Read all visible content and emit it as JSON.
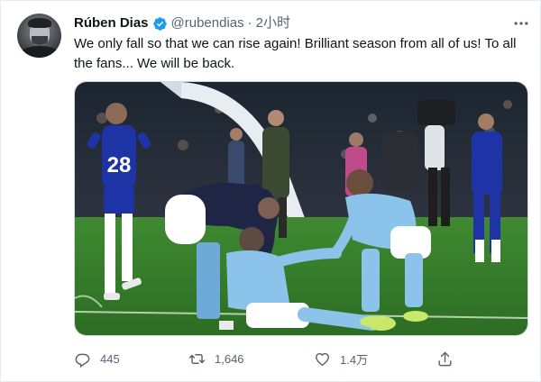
{
  "tweet": {
    "author_name": "Rúben Dias",
    "handle": "@rubendias",
    "separator": "·",
    "time": "2小时",
    "text": "We only fall so that we can rise again! Brilliant season from all of us! To all the fans... We will be back.",
    "jersey_numbers": [
      "28"
    ],
    "actions": {
      "reply_count": "445",
      "retweet_count": "1,646",
      "like_count": "1.4万"
    }
  },
  "icons": {
    "verified": "verified-badge-icon",
    "more": "more-options-icon",
    "reply": "reply-icon",
    "retweet": "retweet-icon",
    "like": "like-icon",
    "share": "share-icon"
  },
  "colors": {
    "verified_blue": "#1d9bf0",
    "secondary_text": "#536471",
    "primary_text": "#0f1419"
  }
}
